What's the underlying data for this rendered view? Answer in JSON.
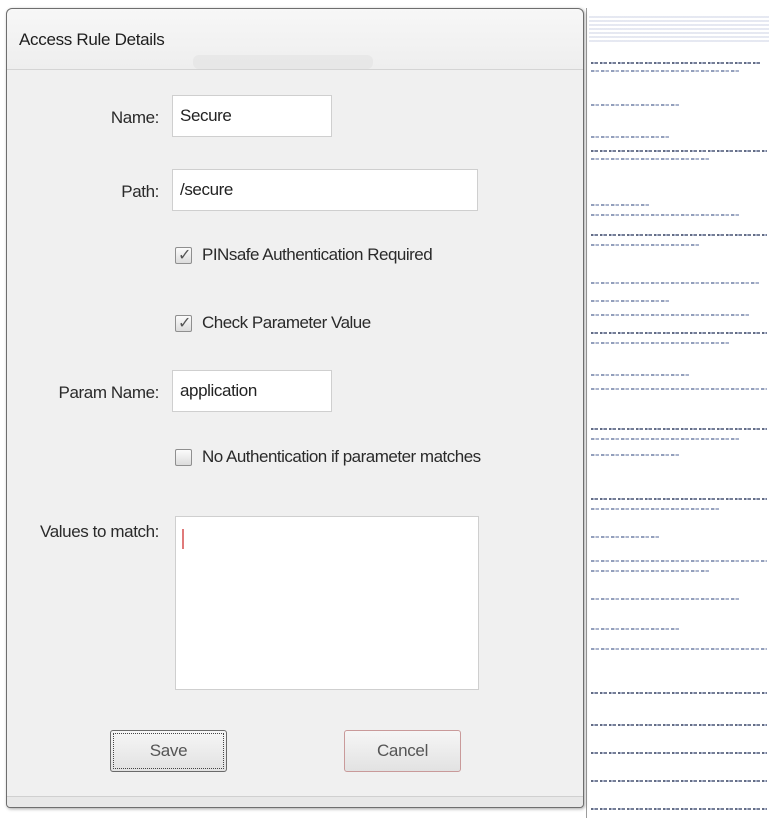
{
  "window": {
    "title": "Access Rule Details"
  },
  "form": {
    "name_label": "Name:",
    "name_value": "Secure",
    "path_label": "Path:",
    "path_value": "/secure",
    "pinsafe_label": "PINsafe Authentication Required",
    "pinsafe_checked": true,
    "check_param_label": "Check Parameter Value",
    "check_param_checked": true,
    "param_name_label": "Param Name:",
    "param_name_value": "application",
    "no_auth_label": "No Authentication if parameter matches",
    "no_auth_checked": false,
    "values_label": "Values to match:",
    "values_value": ""
  },
  "buttons": {
    "save_label": "Save",
    "cancel_label": "Cancel"
  },
  "icons": {
    "checkmark": "checkmark-icon"
  },
  "colors": {
    "dialog_bg": "#f0f0f0",
    "field_bg": "#ffffff",
    "field_border": "#cfcfcf",
    "text": "#2a2a2a"
  }
}
